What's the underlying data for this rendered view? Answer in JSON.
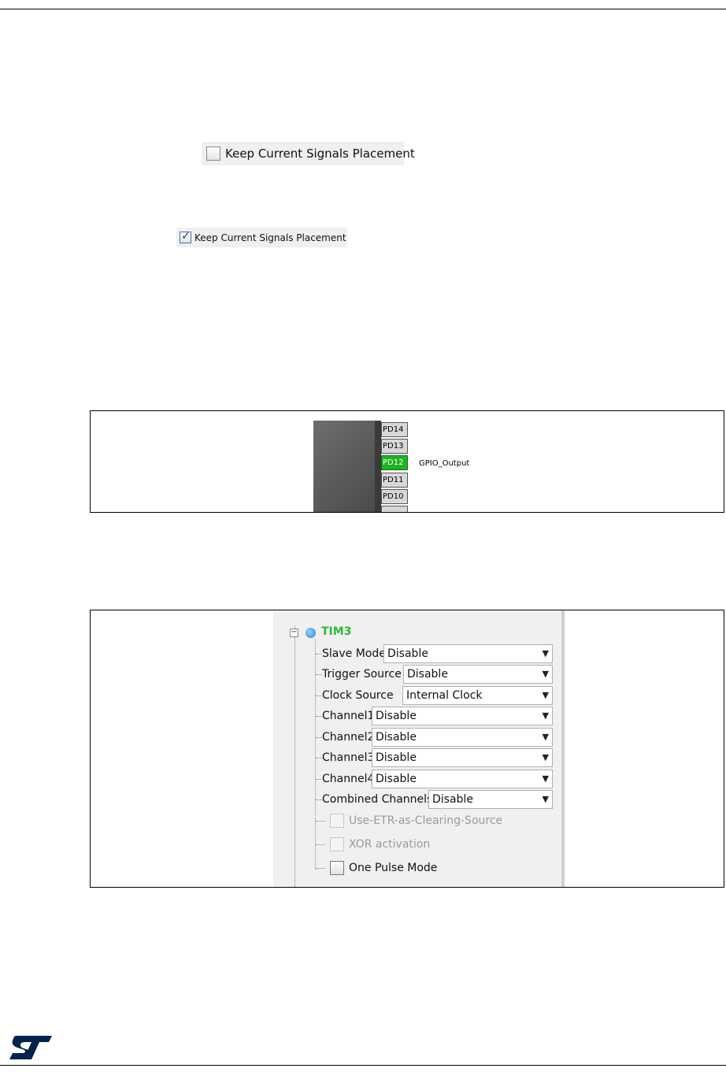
{
  "checkboxes": {
    "unchecked_label": "Keep Current Signals Placement",
    "checked_label": "Keep Current Signals Placement"
  },
  "pin_figure": {
    "pins": [
      "PD14",
      "PD13",
      "PD12",
      "PD11",
      "PD10"
    ],
    "highlight_color": "#1fb31f",
    "signal_label": "GPIO_Output"
  },
  "tree": {
    "node": "TIM3",
    "node_color": "#2fb83a",
    "settings": [
      {
        "label": "Slave Mode",
        "value": "Disable"
      },
      {
        "label": "Trigger Source",
        "value": "Disable"
      },
      {
        "label": "Clock Source",
        "value": "Internal Clock"
      },
      {
        "label": "Channel1",
        "value": "Disable"
      },
      {
        "label": "Channel2",
        "value": "Disable"
      },
      {
        "label": "Channel3",
        "value": "Disable"
      },
      {
        "label": "Channel4",
        "value": "Disable"
      },
      {
        "label": "Combined Channels",
        "value": "Disable"
      }
    ],
    "options": [
      {
        "label": "Use-ETR-as-Clearing-Source",
        "enabled": false
      },
      {
        "label": "XOR activation",
        "enabled": false
      },
      {
        "label": "One Pulse Mode",
        "enabled": true
      }
    ]
  },
  "logo": {
    "name": "st-logo",
    "color": "#03234b"
  }
}
